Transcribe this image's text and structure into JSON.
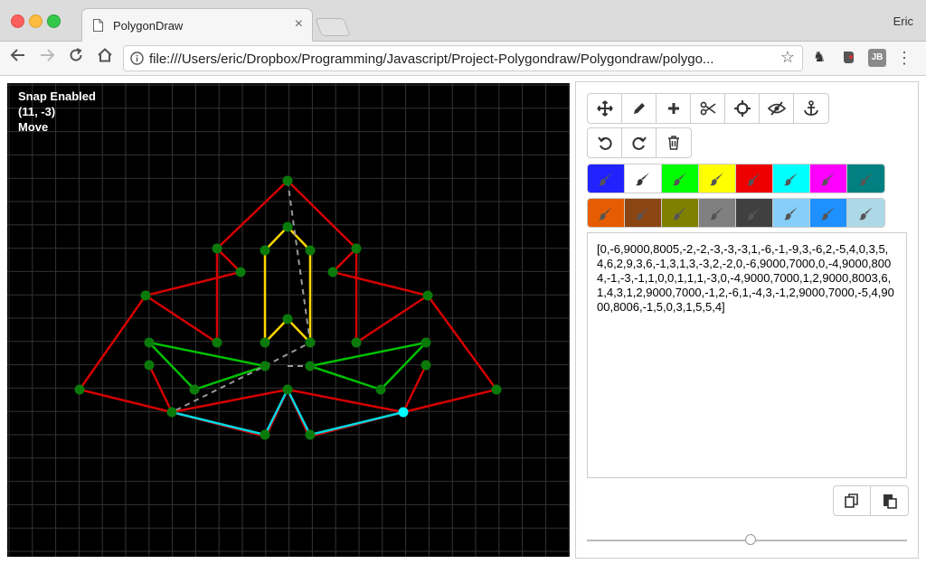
{
  "browser": {
    "tab_title": "PolygonDraw",
    "tab_close": "×",
    "profile_name": "Eric",
    "url": "file:///Users/eric/Dropbox/Programming/Javascript/Project-Polygondraw/Polygondraw/polygo...",
    "ext_jb_label": "JB"
  },
  "canvas": {
    "status_snap": "Snap Enabled",
    "status_coords": "(11, -3)",
    "status_mode": "Move",
    "background": "#000000",
    "grid_color": "#333333"
  },
  "tools": {
    "row1": [
      {
        "name": "move-tool",
        "icon": "arrows-icon"
      },
      {
        "name": "pencil-tool",
        "icon": "pencil-icon"
      },
      {
        "name": "add-tool",
        "icon": "plus-icon"
      },
      {
        "name": "cut-tool",
        "icon": "scissors-icon"
      },
      {
        "name": "crosshair-tool",
        "icon": "crosshair-icon"
      },
      {
        "name": "hide-tool",
        "icon": "eye-slash-icon"
      },
      {
        "name": "anchor-tool",
        "icon": "anchor-icon"
      }
    ],
    "row2": [
      {
        "name": "undo-button",
        "icon": "undo-icon"
      },
      {
        "name": "redo-button",
        "icon": "redo-icon"
      },
      {
        "name": "delete-button",
        "icon": "trash-icon"
      }
    ]
  },
  "palette": {
    "row1": [
      "#2222ff",
      "#ffffff",
      "#00ff00",
      "#ffff00",
      "#ee0000",
      "#00ffff",
      "#ff00ff",
      "#008080"
    ],
    "row2": [
      "#e65c00",
      "#8b4513",
      "#808000",
      "#808080",
      "#404040",
      "#87cefa",
      "#1e90ff",
      "#add8e6"
    ]
  },
  "output_text": "[0,-6,9000,8005,-2,-2,-3,-3,-3,1,-6,-1,-9,3,-6,2,-5,4,0,3,5,4,6,2,9,3,6,-1,3,1,3,-3,2,-2,0,-6,9000,7000,0,-4,9000,8004,-1,-3,-1,1,0,0,1,1,1,-3,0,-4,9000,7000,1,2,9000,8003,6,1,4,3,1,2,9000,7000,-1,2,-6,1,-4,3,-1,2,9000,7000,-5,4,9000,8006,-1,5,0,3,1,5,5,4]",
  "bottom_buttons": [
    {
      "name": "copy-button",
      "icon": "copy-icon"
    },
    {
      "name": "paste-button",
      "icon": "paste-icon"
    }
  ],
  "slider": {
    "value_fraction": 0.51
  }
}
